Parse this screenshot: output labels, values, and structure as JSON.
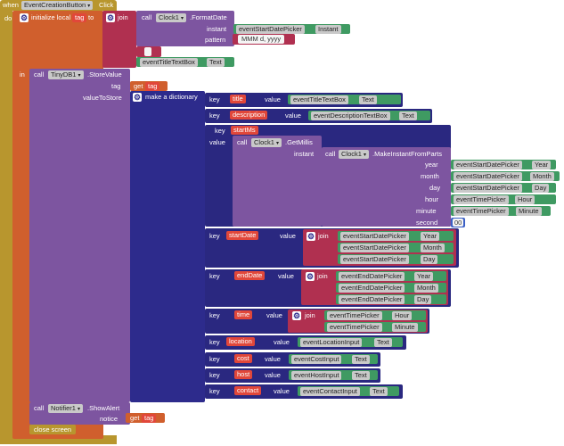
{
  "event": {
    "when": "when",
    "component": "EventCreationButton",
    "event": "Click",
    "do": "do"
  },
  "init": {
    "label": "initialize local",
    "var": "tag",
    "to": "to",
    "in": "in"
  },
  "join_label": "join",
  "call": "call",
  "get": "get",
  "key": "key",
  "value": "value",
  "format": {
    "component": "Clock1",
    "method": ".FormatDate",
    "instant": "instant",
    "pattern": "pattern",
    "instant_comp": "eventStartDatePicker",
    "instant_prop": "Instant",
    "pattern_value": "MMM d, yyyy"
  },
  "sep_value": " ",
  "title_comp": {
    "component": "eventTitleTextBox",
    "prop": "Text"
  },
  "store": {
    "component": "TinyDB1",
    "method": ".StoreValue",
    "tag": "tag",
    "value_to_store": "valueToStore",
    "tag_var": "tag"
  },
  "dict_label": "make a dictionary",
  "entries": {
    "title": {
      "key": "title",
      "comp": "eventTitleTextBox",
      "prop": "Text"
    },
    "description": {
      "key": "description",
      "comp": "eventDescriptionTextBox",
      "prop": "Text"
    },
    "startMs": {
      "key": "startMs"
    },
    "location": {
      "key": "location",
      "comp": "eventLocationInput",
      "prop": "Text"
    },
    "cost": {
      "key": "cost",
      "comp": "eventCostInput",
      "prop": "Text"
    },
    "host": {
      "key": "host",
      "comp": "eventHostInput",
      "prop": "Text"
    },
    "contact": {
      "key": "contact",
      "comp": "eventContactInput",
      "prop": "Text"
    }
  },
  "getmillis": {
    "component": "Clock1",
    "method": ".GetMillis",
    "instant": "instant"
  },
  "parts": {
    "component": "Clock1",
    "method": ".MakeInstantFromParts",
    "rows": [
      {
        "label": "year",
        "comp": "eventStartDatePicker",
        "prop": "Year"
      },
      {
        "label": "month",
        "comp": "eventStartDatePicker",
        "prop": "Month"
      },
      {
        "label": "day",
        "comp": "eventStartDatePicker",
        "prop": "Day"
      },
      {
        "label": "hour",
        "comp": "eventTimePicker",
        "prop": "Hour"
      },
      {
        "label": "minute",
        "comp": "eventTimePicker",
        "prop": "Minute"
      },
      {
        "label": "second",
        "num": "00"
      }
    ]
  },
  "startDate": {
    "key": "startDate",
    "rows": [
      {
        "comp": "eventStartDatePicker",
        "prop": "Year"
      },
      {
        "comp": "eventStartDatePicker",
        "prop": "Month"
      },
      {
        "comp": "eventStartDatePicker",
        "prop": "Day"
      }
    ]
  },
  "endDate": {
    "key": "endDate",
    "rows": [
      {
        "comp": "eventEndDatePicker",
        "prop": "Year"
      },
      {
        "comp": "eventEndDatePicker",
        "prop": "Month"
      },
      {
        "comp": "eventEndDatePicker",
        "prop": "Day"
      }
    ]
  },
  "time": {
    "key": "time",
    "rows": [
      {
        "comp": "eventTimePicker",
        "prop": "Hour"
      },
      {
        "comp": "eventTimePicker",
        "prop": "Minute"
      }
    ]
  },
  "alert": {
    "component": "Notifier1",
    "method": ".ShowAlert",
    "notice": "notice",
    "var": "tag"
  },
  "close": "close screen"
}
